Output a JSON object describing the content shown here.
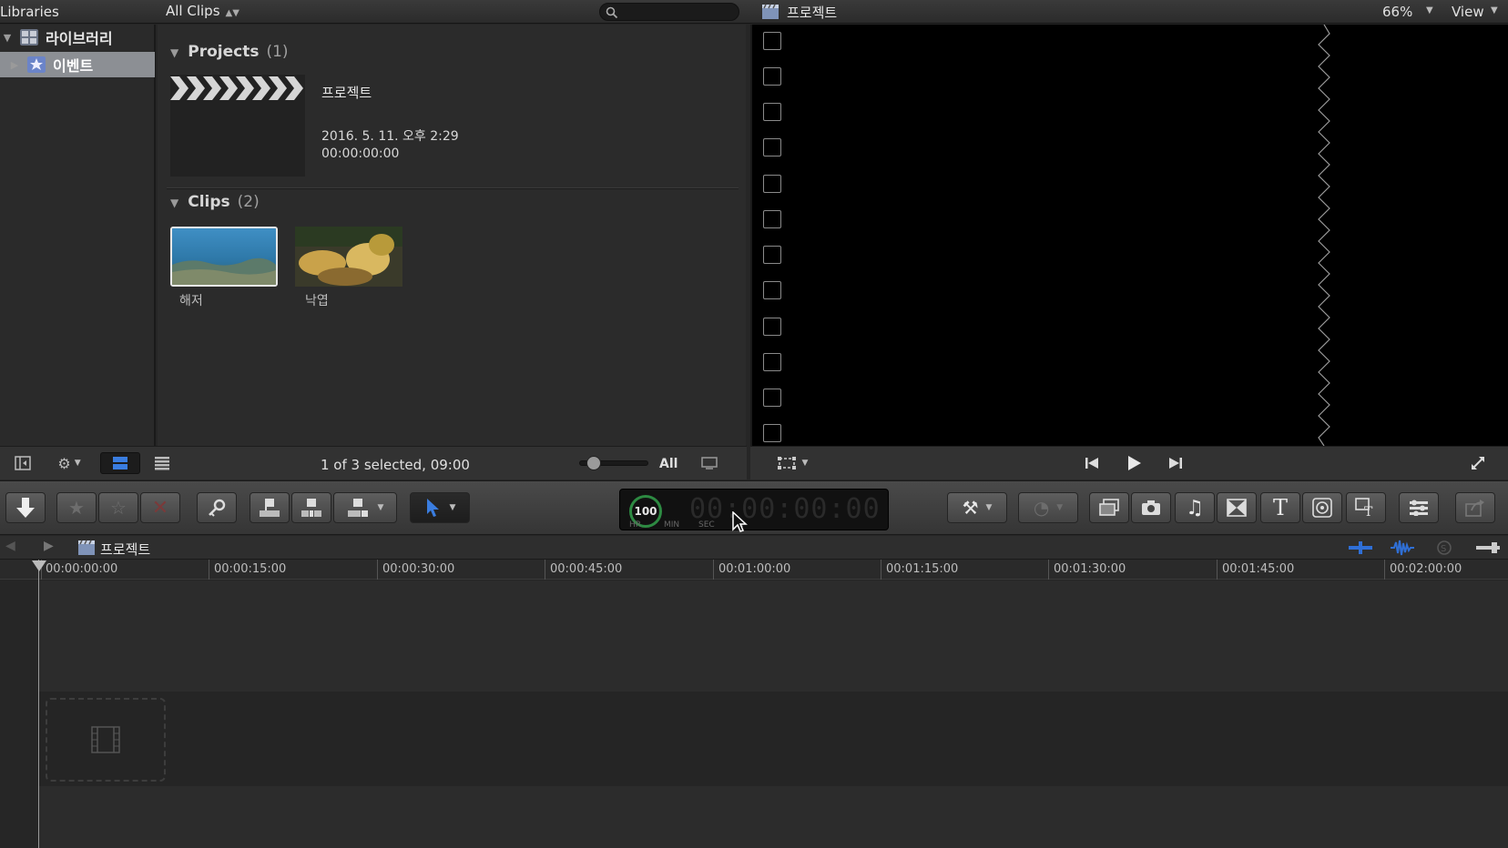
{
  "header": {
    "libraries_label": "Libraries",
    "browser_filter": "All Clips",
    "search_placeholder": "",
    "viewer_title": "프로젝트",
    "zoom": "66%",
    "view_menu": "View"
  },
  "sidebar": {
    "items": [
      {
        "label": "라이브러리",
        "icon": "library-icon"
      },
      {
        "label": "이벤트",
        "icon": "event-star-icon"
      }
    ]
  },
  "browser": {
    "projects": {
      "title": "Projects",
      "count": "(1)"
    },
    "project": {
      "name": "프로젝트",
      "date": "2016. 5. 11. 오후 2:29",
      "duration": "00:00:00:00"
    },
    "clips": {
      "title": "Clips",
      "count": "(2)"
    },
    "clip_items": [
      {
        "label": "해저"
      },
      {
        "label": "낙엽"
      }
    ],
    "footer": {
      "selection_info": "1 of 3 selected, 09:00",
      "zoom_all": "All"
    }
  },
  "toolbar": {
    "timecode": {
      "percent": "100",
      "digits": "00:00:00:00",
      "units": [
        "HR",
        "MIN",
        "SEC",
        "FR"
      ]
    }
  },
  "timeline": {
    "project_name": "프로젝트",
    "ruler": [
      "00:00:00:00",
      "00:00:15:00",
      "00:00:30:00",
      "00:00:45:00",
      "00:01:00:00",
      "00:01:15:00",
      "00:01:30:00",
      "00:01:45:00",
      "00:02:00:00"
    ]
  },
  "colors": {
    "accent_blue": "#2f6fd6",
    "timecode_green": "#2d8a42",
    "selection_gray": "#8c8f94"
  }
}
